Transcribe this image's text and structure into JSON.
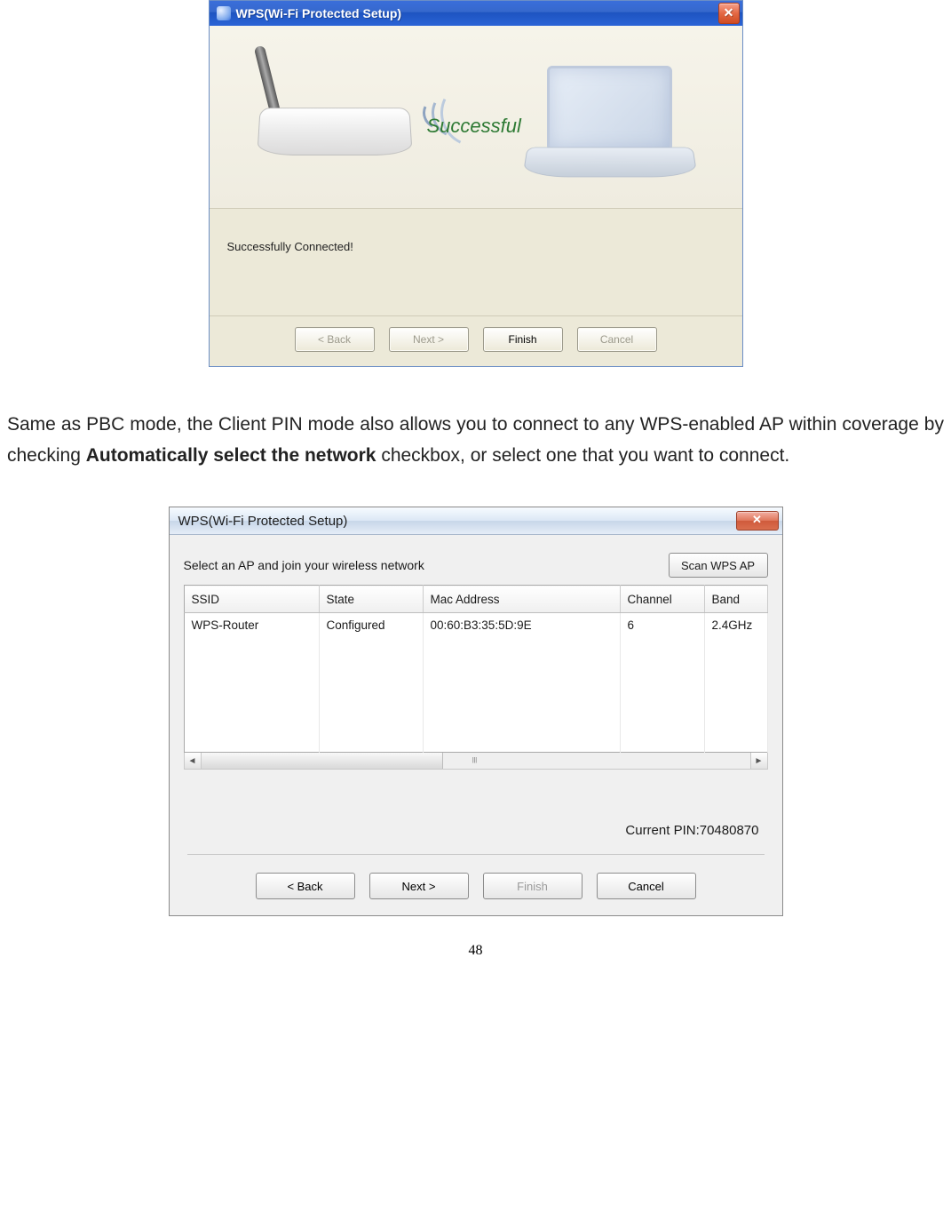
{
  "dialog1": {
    "title": "WPS(Wi-Fi Protected Setup)",
    "successful_graphic_label": "Successful",
    "status_text": "Successfully Connected!",
    "buttons": {
      "back": {
        "label": "< Back",
        "enabled": false
      },
      "next": {
        "label": "Next >",
        "enabled": false
      },
      "finish": {
        "label": "Finish",
        "enabled": true
      },
      "cancel": {
        "label": "Cancel",
        "enabled": false
      }
    }
  },
  "paragraph": {
    "pre": "Same as PBC mode, the Client PIN mode also allows you to connect to any WPS-enabled AP within coverage by checking ",
    "bold": "Automatically select the network",
    "post": " checkbox, or select one that you want to connect."
  },
  "dialog2": {
    "title": "WPS(Wi-Fi Protected Setup)",
    "instruction": "Select an AP and join your wireless network",
    "scan_button_label": "Scan WPS AP",
    "table": {
      "headers": {
        "ssid": "SSID",
        "state": "State",
        "mac": "Mac Address",
        "channel": "Channel",
        "band": "Band"
      },
      "rows": [
        {
          "ssid": "WPS-Router",
          "state": "Configured",
          "mac": "00:60:B3:35:5D:9E",
          "channel": "6",
          "band": "2.4GHz"
        }
      ],
      "blank_row_count": 5
    },
    "current_pin_label": "Current PIN:",
    "current_pin_value": "70480870",
    "buttons": {
      "back": {
        "label": "< Back",
        "enabled": true
      },
      "next": {
        "label": "Next >",
        "enabled": true
      },
      "finish": {
        "label": "Finish",
        "enabled": false
      },
      "cancel": {
        "label": "Cancel",
        "enabled": true
      }
    }
  },
  "page_number": "48"
}
